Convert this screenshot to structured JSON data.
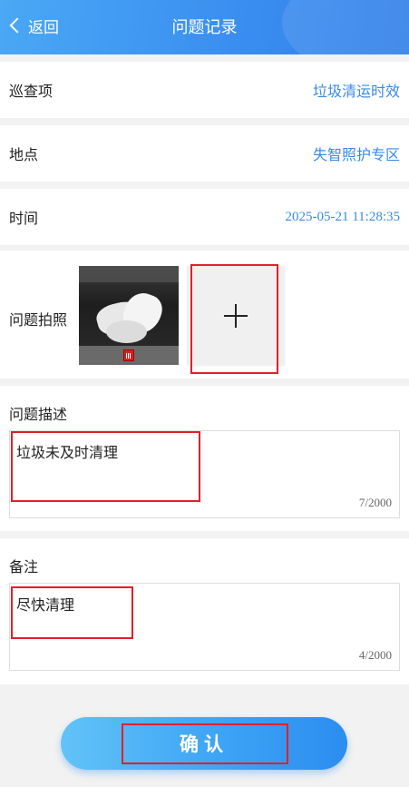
{
  "header": {
    "back_label": "返回",
    "title": "问题记录"
  },
  "fields": [
    {
      "label": "巡查项",
      "value": "垃圾清运时效"
    },
    {
      "label": "地点",
      "value": "失智照护专区"
    },
    {
      "label": "时间",
      "value": "2025-05-21 11:28:35"
    }
  ],
  "photo": {
    "label": "问题拍照"
  },
  "description": {
    "label": "问题描述",
    "text": "垃圾未及时清理",
    "count": "7/2000"
  },
  "remark": {
    "label": "备注",
    "text": "尽快清理",
    "count": "4/2000"
  },
  "confirm_label": "确认",
  "colors": {
    "accent": "#3a8ae6",
    "highlight": "#e0202a"
  }
}
